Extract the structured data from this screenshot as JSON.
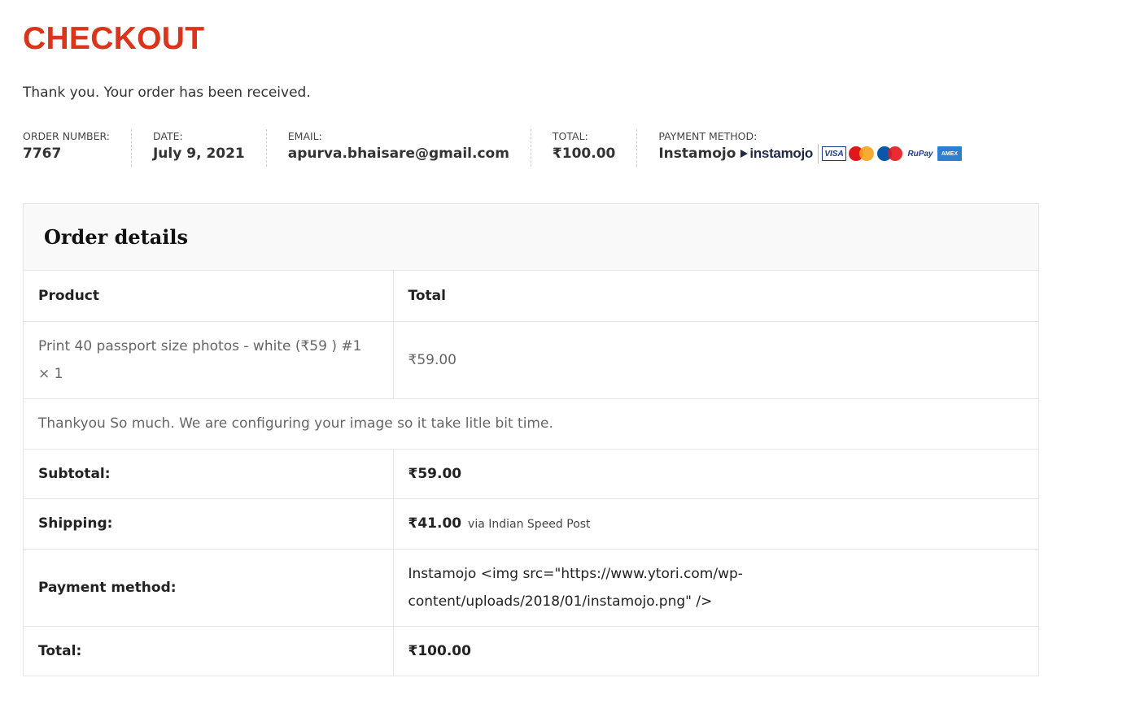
{
  "page": {
    "title": "CHECKOUT",
    "thank_you": "Thank you. Your order has been received."
  },
  "order_overview": {
    "order_number_label": "ORDER NUMBER:",
    "order_number": "7767",
    "date_label": "DATE:",
    "date": "July 9, 2021",
    "email_label": "EMAIL:",
    "email": "apurva.bhaisare@gmail.com",
    "total_label": "TOTAL:",
    "total": "₹100.00",
    "payment_method_label": "PAYMENT METHOD:",
    "payment_method": "Instamojo",
    "payment_logo_text": "instamojo",
    "card_logos": [
      "VISA",
      "MasterCard",
      "Maestro",
      "RuPay",
      "AMERICAN EXPRESS"
    ]
  },
  "order_details": {
    "heading": "Order details",
    "columns": [
      "Product",
      "Total"
    ],
    "item": {
      "name": "Print 40 passport size photos - white (₹59 ) #1",
      "quantity": "× 1",
      "total": "₹59.00"
    },
    "note": "Thankyou So much. We are configuring your image so it take litle bit time.",
    "subtotal_label": "Subtotal:",
    "subtotal": "₹59.00",
    "shipping_label": "Shipping:",
    "shipping": "₹41.00",
    "shipping_via": "via Indian Speed Post",
    "payment_label": "Payment method:",
    "payment_value": "Instamojo <img src=\"https://www.ytori.com/wp-content/uploads/2018/01/instamojo.png\" />",
    "total_label": "Total:",
    "total": "₹100.00"
  },
  "colors": {
    "title": "#d9351b",
    "border": "#e6e6e6",
    "header_bg": "#f9f9f9"
  }
}
